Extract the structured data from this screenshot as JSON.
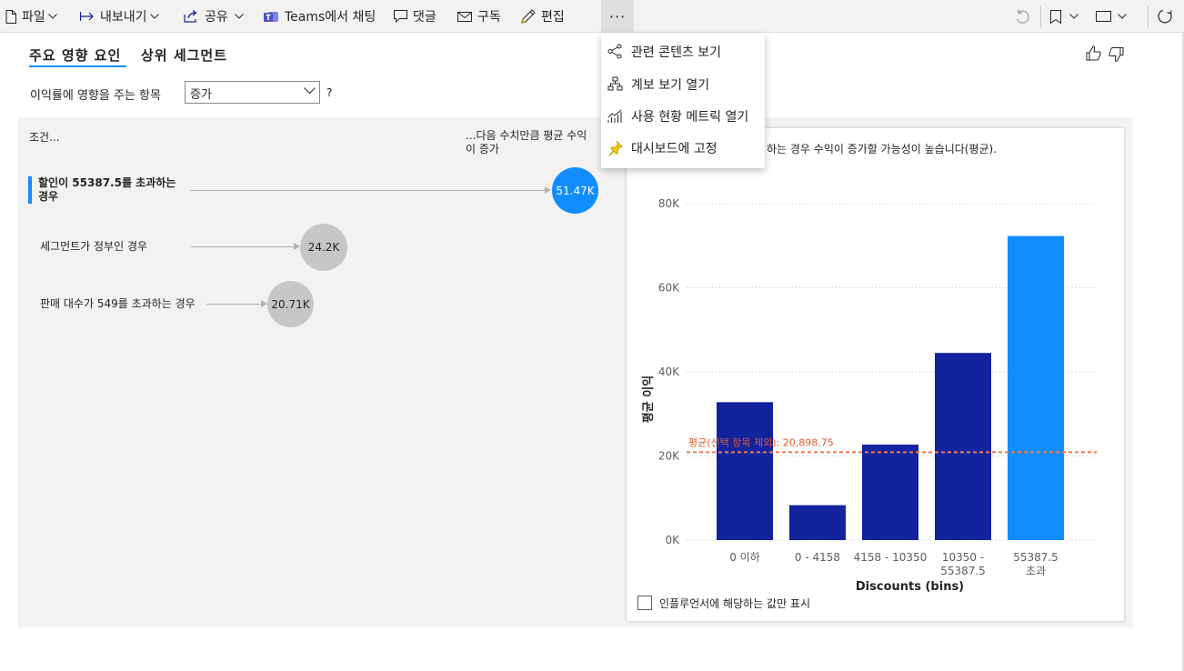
{
  "toolbar": {
    "file": "파일",
    "export": "내보내기",
    "share": "공유",
    "teams": "Teams에서 채팅",
    "comment": "댓글",
    "subscribe": "구독",
    "edit": "편집",
    "more": "···"
  },
  "more_menu": {
    "items": [
      {
        "label": "관련 콘텐츠 보기",
        "icon": "related-content-icon"
      },
      {
        "label": "계보 보기 열기",
        "icon": "lineage-icon"
      },
      {
        "label": "사용 현황 메트릭 열기",
        "icon": "usage-metrics-icon"
      },
      {
        "label": "대시보드에 고정",
        "icon": "pin-icon"
      }
    ]
  },
  "visual": {
    "tab_key_influencers": "주요 영향 요인",
    "tab_top_segments": "상위 세그먼트",
    "analyze_label": "이익률에 영향을 주는 항목",
    "analyze_value": "증가",
    "help": "?",
    "when_label": "조건...",
    "increase_label": "...다음 수치만큼 평균 수익이 증가",
    "influencers": [
      {
        "text": "할인이 55387.5를 초과하는 경우",
        "value": "51.47K",
        "selected": true
      },
      {
        "text": "세그먼트가 정부인 경우",
        "value": "24.2K",
        "selected": false
      },
      {
        "text": "판매 대수가 549를 초과하는 경우",
        "value": "20.71K",
        "selected": false
      }
    ],
    "chart_description": "하는 경우 수익이 증가할 가능성이 높습니다(평균).",
    "only_influencers_label": "인플루언서에 해당하는 값만 표시"
  },
  "chart_data": {
    "type": "bar",
    "categories": [
      "0 이하",
      "0 - 4158",
      "4158 - 10350",
      "10350 - 55387.5",
      "55387.5 초과"
    ],
    "category_lines": [
      [
        "0 이하"
      ],
      [
        "0 - 4158"
      ],
      [
        "4158 - 10350"
      ],
      [
        "10350 -",
        "55387.5"
      ],
      [
        "55387.5",
        "초과"
      ]
    ],
    "values": [
      32800,
      8300,
      22700,
      44500,
      72300
    ],
    "highlight_index": 4,
    "colors": {
      "normal": "#12239e",
      "highlight": "#118dff",
      "average_line": "#f2784b"
    },
    "xlabel": "Discounts (bins)",
    "ylabel": "평균 이익",
    "ylim": [
      0,
      80000
    ],
    "y_ticks": [
      0,
      20000,
      40000,
      60000,
      80000
    ],
    "y_tick_labels": [
      "0K",
      "20K",
      "40K",
      "60K",
      "80K"
    ],
    "average_value": 20898.75,
    "average_label": "평균(선택 항목 제외): 20,898.75",
    "grid": true
  }
}
